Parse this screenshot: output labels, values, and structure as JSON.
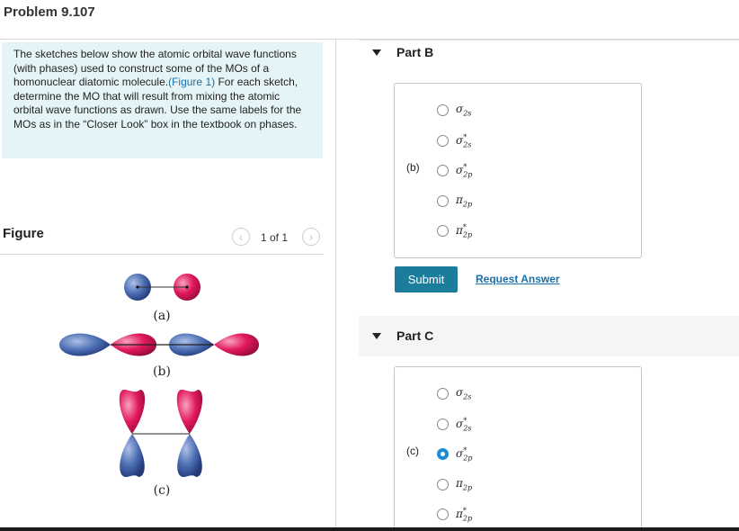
{
  "problem": {
    "title": "Problem 9.107"
  },
  "intro": {
    "text_before_link": "The sketches below show the atomic orbital wave functions (with phases) used to construct some of the MOs of a homonuclear diatomic molecule.",
    "link_text": "(Figure 1)",
    "text_after_link": " For each sketch, determine the MO that will result from mixing the atomic orbital wave functions as drawn. Use the same labels for the MOs as in the “Closer Look” box in the textbook on phases."
  },
  "figure": {
    "label": "Figure",
    "page_indicator": "1 of 1",
    "prev_icon": "chevron-left-icon",
    "next_icon": "chevron-right-icon",
    "sketch_labels": [
      "(a)",
      "(b)",
      "(c)"
    ],
    "colors": {
      "blue_lobe": "#4a6db0",
      "pink_lobe": "#e2185e"
    }
  },
  "parts": [
    {
      "title": "Part B",
      "sketch_label": "(b)",
      "options": [
        {
          "sym": "σ",
          "sub": "2s",
          "sup": ""
        },
        {
          "sym": "σ",
          "sub": "2s",
          "sup": "*"
        },
        {
          "sym": "σ",
          "sub": "2p",
          "sup": "*"
        },
        {
          "sym": "π",
          "sub": "2p",
          "sup": ""
        },
        {
          "sym": "π",
          "sub": "2p",
          "sup": "*"
        }
      ],
      "selected_index": null,
      "submit_label": "Submit",
      "request_answer_label": "Request Answer"
    },
    {
      "title": "Part C",
      "sketch_label": "(c)",
      "options": [
        {
          "sym": "σ",
          "sub": "2s",
          "sup": ""
        },
        {
          "sym": "σ",
          "sub": "2s",
          "sup": "*"
        },
        {
          "sym": "σ",
          "sub": "2p",
          "sup": "*"
        },
        {
          "sym": "π",
          "sub": "2p",
          "sup": ""
        },
        {
          "sym": "π",
          "sub": "2p",
          "sup": "*"
        }
      ],
      "selected_index": 2
    }
  ],
  "colors": {
    "accent": "#1b7d9b",
    "link": "#1a6fa8",
    "radio_selected": "#1e8bd6",
    "intro_bg": "#e5f4f6"
  }
}
